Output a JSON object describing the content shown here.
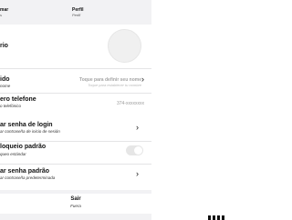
{
  "tabs": {
    "left": {
      "title": "mar",
      "subtitle": "s"
    },
    "right": {
      "title": "Perfil",
      "subtitle": "Perfil"
    }
  },
  "profile_photo": {
    "label": "rio"
  },
  "nickname": {
    "title": "ido",
    "subtitle": "nome",
    "hint": "Toque para definir seu nome",
    "hint_sub": "Toque para establecer tu nombre"
  },
  "phone": {
    "title": "ero telefone",
    "subtitle": "o telefónico",
    "value": "374-xxxxxxxx"
  },
  "login_password": {
    "title": "ar senha de login",
    "subtitle": "ar contraseña de inicio de sesión"
  },
  "default_lock": {
    "title": "loqueio  padrão",
    "subtitle": "queo estándar",
    "enabled": false
  },
  "default_password": {
    "title": "ar senha padrão",
    "subtitle": "ar contraseña predeterminada"
  },
  "exit": {
    "title": "Sair",
    "subtitle": "Fuera"
  },
  "colors": {
    "background": "#f2f2f4",
    "card": "#ffffff",
    "hint": "#a4a4a4",
    "toggle_off": "#e6e6e6"
  },
  "icons": {
    "chevron": "›"
  }
}
